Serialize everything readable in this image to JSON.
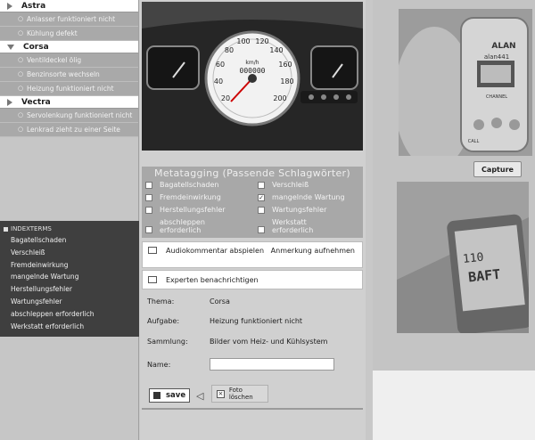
{
  "categories": [
    {
      "name": "Astra",
      "expanded": false,
      "items": [
        "Anlasser funktioniert nicht",
        "Kühlung defekt"
      ]
    },
    {
      "name": "Corsa",
      "expanded": true,
      "items": [
        "Ventildeckel ölig",
        "Benzinsorte wechseln",
        "Heizung funktioniert nicht"
      ]
    },
    {
      "name": "Vectra",
      "expanded": false,
      "items": [
        "Servolenkung funktioniert nicht",
        "Lenkrad zieht zu einer Seite"
      ]
    }
  ],
  "index_panel": {
    "title": "INDEXTERMS",
    "items": [
      "Bagatellschaden",
      "Verschleiß",
      "Fremdeinwirkung",
      "mangelnde Wartung",
      "Herstellungsfehler",
      "Wartungsfehler",
      "abschleppen erforderlich",
      "Werkstatt erforderlich"
    ]
  },
  "photo_main": {
    "gauge_labels": [
      "20",
      "40",
      "60",
      "80",
      "100",
      "120",
      "140",
      "160",
      "180",
      "200"
    ],
    "km_label": "km/h",
    "odometer": "000000"
  },
  "metatagging": {
    "title": "Metatagging (Passende Schlagwörter)",
    "tags": [
      {
        "label": "Bagatellschaden",
        "checked": false
      },
      {
        "label": "Verschleiß",
        "checked": false
      },
      {
        "label": "Fremdeinwirkung",
        "checked": false
      },
      {
        "label": "mangelnde Wartung",
        "checked": true
      },
      {
        "label": "Herstellungsfehler",
        "checked": false
      },
      {
        "label": "Wartungsfehler",
        "checked": false
      },
      {
        "label": "abschleppen erforderlich",
        "checked": false
      },
      {
        "label": "Werkstatt erforderlich",
        "checked": false
      }
    ]
  },
  "audio_row": {
    "label": "Audiokommentar abspielen",
    "link": "Anmerkung aufnehmen"
  },
  "expert_row": {
    "label": "Experten benachrichtigen"
  },
  "details": {
    "thema_label": "Thema:",
    "thema_value": "Corsa",
    "aufgabe_label": "Aufgabe:",
    "aufgabe_value": "Heizung funktioniert nicht",
    "sammlung_label": "Sammlung:",
    "sammlung_value": "Bilder vom Heiz- und Kühlsystem",
    "name_label": "Name:",
    "name_value": ""
  },
  "buttons": {
    "save": "save",
    "delete": "Foto löschen",
    "capture": "Capture"
  },
  "radio_photo": {
    "brand": "ALAN",
    "model": "alan441",
    "channel": "CHANNEL",
    "call": "CALL"
  },
  "device_photo": {
    "screen_text": "BAFT",
    "screen_digits": "110"
  }
}
